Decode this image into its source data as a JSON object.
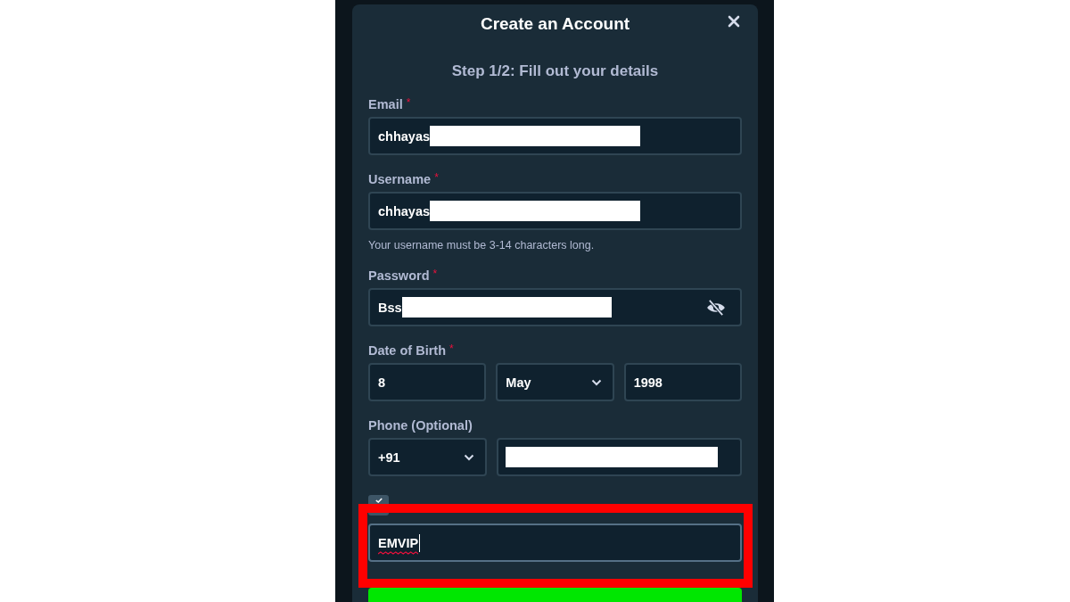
{
  "dialog": {
    "title": "Create an Account",
    "step": "Step 1/2: Fill out your details"
  },
  "fields": [
    {
      "kind": "text",
      "label": "Email",
      "required_mark": "*",
      "value": "chhayas",
      "redacted": true
    },
    {
      "kind": "text",
      "label": "Username",
      "required_mark": "*",
      "value": "chhayas",
      "redacted": true,
      "hint": "Your username must be 3-14 characters long."
    },
    {
      "kind": "password",
      "label": "Password",
      "required_mark": "*",
      "value": "Bss",
      "redacted": true
    }
  ],
  "date_of_birth": {
    "label": "Date of Birth",
    "required_mark": "*",
    "day": "8",
    "month": "May",
    "year": "1998"
  },
  "phone": {
    "label": "Phone (Optional)",
    "country_code": "+91",
    "redacted": true
  },
  "code": {
    "checked": true,
    "value": "EMVIP",
    "spell_error": true,
    "highlighted": true
  }
}
